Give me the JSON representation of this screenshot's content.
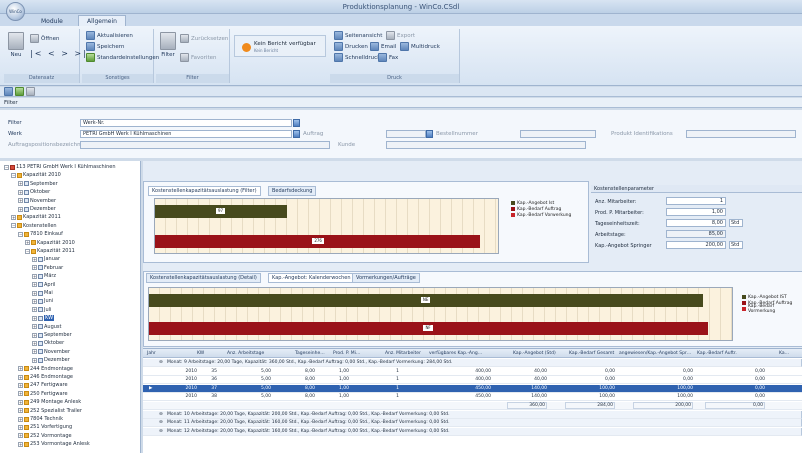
{
  "app": {
    "title": "Produktionsplanung - WinCo.CSdl",
    "orb": "WinCo",
    "tabs": [
      {
        "label": "Module",
        "active": false
      },
      {
        "label": "Allgemein",
        "active": true
      }
    ]
  },
  "ribbon": {
    "groups": {
      "datensatz": {
        "label": "Datensatz",
        "items": [
          "Neu",
          "Öffnen",
          "Speichern"
        ]
      },
      "sonstiges": {
        "label": "Sonstiges",
        "items": [
          "Aktualisieren",
          "Speichern",
          "Standardeinstellungen"
        ]
      },
      "filter": {
        "label": "Filter",
        "items": [
          "Filter",
          "Zurücksetzen",
          "Favoriten"
        ]
      },
      "report": {
        "main": "Kein Bericht verfügbar",
        "sub": "Kein Bericht"
      },
      "druck": {
        "label": "Druck",
        "items": [
          "Seitenansicht",
          "Export",
          "Drucken",
          "Email",
          "Multidruck",
          "Schnelldruck",
          "Fax"
        ]
      }
    }
  },
  "subheader": {
    "title": "Filter"
  },
  "filter": {
    "fields": {
      "filter_label": "Filter",
      "filter_value": "Werk-Nr.",
      "werk_label": "Werk",
      "werk_value": "PETRI GmbH Werk I Kühlmaschinen",
      "auftrag_label": "Auftrag",
      "auftrag_value": "",
      "bestellnummer_label": "Bestellnummer",
      "bestellnummer_value": "",
      "produkt_label": "Produkt Identifikations",
      "produkt_value": "",
      "aufgaben_label": "Auftragspositionsbezeichnung",
      "aufgaben_value": "",
      "kunde_label": "Kunde",
      "kunde_value": ""
    }
  },
  "tree": {
    "nodes": [
      {
        "label": "113 PETRI GmbH Werk I Kühlmaschinen",
        "level": 0,
        "exp": "−",
        "icon": "red"
      },
      {
        "label": "Kapazität 2010",
        "level": 1,
        "exp": "−",
        "icon": "folder"
      },
      {
        "label": "September",
        "level": 2,
        "exp": "+",
        "icon": "cal"
      },
      {
        "label": "Oktober",
        "level": 2,
        "exp": "+",
        "icon": "cal"
      },
      {
        "label": "November",
        "level": 2,
        "exp": "+",
        "icon": "cal"
      },
      {
        "label": "Dezember",
        "level": 2,
        "exp": "+",
        "icon": "cal"
      },
      {
        "label": "Kapazität 2011",
        "level": 1,
        "exp": "+",
        "icon": "folder"
      },
      {
        "label": "Kostenstellen",
        "level": 1,
        "exp": "−",
        "icon": "folder"
      },
      {
        "label": "7810 Einkauf",
        "level": 2,
        "exp": "−",
        "icon": "folder"
      },
      {
        "label": "Kapazität 2010",
        "level": 3,
        "exp": "+",
        "icon": "folder"
      },
      {
        "label": "Kapazität 2011",
        "level": 3,
        "exp": "−",
        "icon": "folder"
      },
      {
        "label": "Januar",
        "level": 4,
        "exp": "+",
        "icon": "cal"
      },
      {
        "label": "Februar",
        "level": 4,
        "exp": "+",
        "icon": "cal"
      },
      {
        "label": "März",
        "level": 4,
        "exp": "+",
        "icon": "cal"
      },
      {
        "label": "April",
        "level": 4,
        "exp": "+",
        "icon": "cal"
      },
      {
        "label": "Mai",
        "level": 4,
        "exp": "+",
        "icon": "cal"
      },
      {
        "label": "Juni",
        "level": 4,
        "exp": "+",
        "icon": "cal"
      },
      {
        "label": "Juli",
        "level": 4,
        "exp": "+",
        "icon": "cal"
      },
      {
        "label": "KW",
        "level": 4,
        "exp": "+",
        "icon": "cal",
        "selected": true
      },
      {
        "label": "August",
        "level": 4,
        "exp": "+",
        "icon": "cal"
      },
      {
        "label": "September",
        "level": 4,
        "exp": "+",
        "icon": "cal"
      },
      {
        "label": "Oktober",
        "level": 4,
        "exp": "+",
        "icon": "cal"
      },
      {
        "label": "November",
        "level": 4,
        "exp": "+",
        "icon": "cal"
      },
      {
        "label": "Dezember",
        "level": 4,
        "exp": "+",
        "icon": "cal"
      },
      {
        "label": "244 Endmontage",
        "level": 2,
        "exp": "+",
        "icon": "folder"
      },
      {
        "label": "246 Endmontage",
        "level": 2,
        "exp": "+",
        "icon": "folder"
      },
      {
        "label": "247 Fertigware",
        "level": 2,
        "exp": "+",
        "icon": "folder"
      },
      {
        "label": "250 Fertigware",
        "level": 2,
        "exp": "+",
        "icon": "folder"
      },
      {
        "label": "249 Montage Anlesk",
        "level": 2,
        "exp": "+",
        "icon": "folder"
      },
      {
        "label": "252 Spezialist Trailer",
        "level": 2,
        "exp": "+",
        "icon": "folder"
      },
      {
        "label": "7804 Technik",
        "level": 2,
        "exp": "+",
        "icon": "folder"
      },
      {
        "label": "251 Vorfertigung",
        "level": 2,
        "exp": "+",
        "icon": "folder"
      },
      {
        "label": "252 Vormontage",
        "level": 2,
        "exp": "+",
        "icon": "folder"
      },
      {
        "label": "253 Vormontage Anlesk",
        "level": 2,
        "exp": "+",
        "icon": "folder"
      }
    ]
  },
  "top_panel": {
    "tabs": [
      {
        "label": "Kostenstellenkapazitätsauslastung (Filter)",
        "active": true
      },
      {
        "label": "Bedarfsdeckung",
        "active": false
      }
    ],
    "bars": [
      {
        "series": "ist",
        "value": 130,
        "label": "97"
      },
      {
        "series": "auf",
        "value": 320,
        "label": "276"
      }
    ],
    "axis_max": 340,
    "legend": [
      {
        "label": "Kap.-Angebot Ist",
        "color": "#474a1d"
      },
      {
        "label": "Kap.-Bedarf Auftrag",
        "color": "#9a1218"
      },
      {
        "label": "Kap.-Bedarf Vorwerkung",
        "color": "#c8242a"
      }
    ]
  },
  "kostenstellen_params": {
    "title": "Kostenstellenparameter",
    "rows": [
      {
        "label": "Anz. Mitarbeiter:",
        "value": "1",
        "unit": "",
        "ro": false
      },
      {
        "label": "Prod. P. Mitarbeiter:",
        "value": "1,00",
        "unit": "",
        "ro": false
      },
      {
        "label": "Tageseinheitszeit:",
        "value": "8,00",
        "unit": "Std",
        "ro": false
      },
      {
        "label": "Arbeitstage:",
        "value": "85,00",
        "unit": "",
        "ro": true
      },
      {
        "label": "Kap.-Angebot Springer",
        "value": "200,00",
        "unit": "Std",
        "ro": false
      }
    ]
  },
  "middle_panel": {
    "tabs": [
      {
        "label": "Kostenstellenkapazitätsauslastung (Detail)",
        "active": false
      },
      {
        "label": "Kap.-Angebot: Kalenderwochen",
        "active": true
      },
      {
        "label": "Vormerkungen/Aufträge",
        "active": false
      }
    ],
    "bars": [
      {
        "series": "ist",
        "value": 530,
        "label": "NE"
      },
      {
        "series": "auf",
        "value": 535,
        "label": "NF"
      }
    ],
    "axis_max": 560,
    "legend": [
      {
        "label": "Kap.-Angebot IST",
        "color": "#474a1d"
      },
      {
        "label": "Kap.-Bedarf Auftrag",
        "color": "#9a1218"
      },
      {
        "label": "Kap.-Bedarf Vormerkung",
        "color": "#c8242a"
      }
    ]
  },
  "grid": {
    "headers": [
      "Jahr",
      "KW",
      "Anz. Arbeitstage",
      "Tageseinhe…",
      "Prod. P. Mi…",
      "Anz. Mitarbeiter",
      "verfügbares Kap.-Ang…",
      "Kap.-Angebot (Std)",
      "Kap.-Bedarf Gesamt",
      "angewiesen/Kap.-Angebot Spr…",
      "Kap.-Bedarf Auftr.",
      "Ka…"
    ],
    "rows": [
      {
        "type": "group",
        "text": "Monat: 9 Arbeitstage: 20,00 Tage, Kapazität: 360,00 Std., Kap.-Bedarf Auftrag: 0,00 Std., Kap.-Bedarf Vormerkung: 284,00 Std."
      },
      {
        "type": "data",
        "cells": [
          "2010",
          "35",
          "5,00",
          "8,00",
          "1,00",
          "1",
          "400,00",
          "40,00",
          "0,00",
          "0,00",
          "0,00"
        ]
      },
      {
        "type": "data",
        "cells": [
          "2010",
          "36",
          "5,00",
          "8,00",
          "1,00",
          "1",
          "400,00",
          "40,00",
          "0,00",
          "0,00",
          "0,00"
        ]
      },
      {
        "type": "sel",
        "cells": [
          "2010",
          "37",
          "5,00",
          "8,00",
          "1,00",
          "1",
          "450,00",
          "140,00",
          "100,00",
          "100,00",
          "0,00"
        ]
      },
      {
        "type": "data",
        "cells": [
          "2010",
          "38",
          "5,00",
          "8,00",
          "1,00",
          "1",
          "450,00",
          "140,00",
          "100,00",
          "100,00",
          "0,00"
        ]
      },
      {
        "type": "total",
        "cells": [
          "",
          "",
          "",
          "",
          "",
          "",
          "",
          "360,00",
          "284,00",
          "200,00",
          "0,00"
        ]
      },
      {
        "type": "group",
        "text": "Monat: 10 Arbeitstage: 20,00 Tage, Kapazität: 200,00 Std., Kap.-Bedarf Auftrag: 0,00 Std., Kap.-Bedarf Vormerkung: 0,00 Std."
      },
      {
        "type": "group",
        "text": "Monat: 11 Arbeitstage: 20,00 Tage, Kapazität: 160,00 Std., Kap.-Bedarf Auftrag: 0,00 Std., Kap.-Bedarf Vormerkung: 0,00 Std."
      },
      {
        "type": "group",
        "text": "Monat: 12 Arbeitstage: 20,00 Tage, Kapazität: 160,00 Std., Kap.-Bedarf Auftrag: 0,00 Std., Kap.-Bedarf Vormerkung: 0,00 Std."
      }
    ]
  }
}
